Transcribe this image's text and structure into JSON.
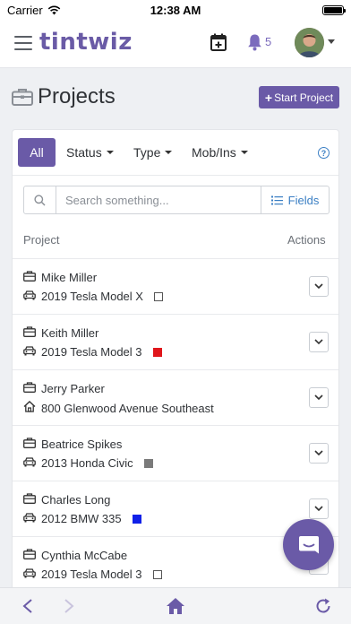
{
  "status_bar": {
    "carrier": "Carrier",
    "time": "12:38 AM"
  },
  "topnav": {
    "logo": "tintwiz",
    "notification_count": "5"
  },
  "page": {
    "title": "Projects",
    "start_button": "Start Project"
  },
  "filters": {
    "all": "All",
    "status": "Status",
    "type": "Type",
    "mob_ins": "Mob/Ins",
    "help": "?"
  },
  "search": {
    "placeholder": "Search something...",
    "value": "",
    "fields_label": "Fields"
  },
  "table": {
    "col_project": "Project",
    "col_actions": "Actions",
    "rows": [
      {
        "name": "Mike Miller",
        "detail": "2019 Tesla Model X",
        "detail_icon": "car-icon",
        "swatch": "#ffffff"
      },
      {
        "name": "Keith Miller",
        "detail": "2019 Tesla Model 3",
        "detail_icon": "car-icon",
        "swatch": "#e0161b"
      },
      {
        "name": "Jerry Parker",
        "detail": "800 Glenwood Avenue Southeast",
        "detail_icon": "home-icon",
        "swatch": ""
      },
      {
        "name": "Beatrice Spikes",
        "detail": "2013 Honda Civic",
        "detail_icon": "car-icon",
        "swatch": "#7a7a7a"
      },
      {
        "name": "Charles Long",
        "detail": "2012 BMW 335",
        "detail_icon": "car-icon",
        "swatch": "#1020e8"
      },
      {
        "name": "Cynthia McCabe",
        "detail": "2019 Tesla Model 3",
        "detail_icon": "car-icon",
        "swatch": "#ffffff"
      }
    ]
  },
  "colors": {
    "brand": "#6a5aa7",
    "link": "#3b7fc4"
  }
}
